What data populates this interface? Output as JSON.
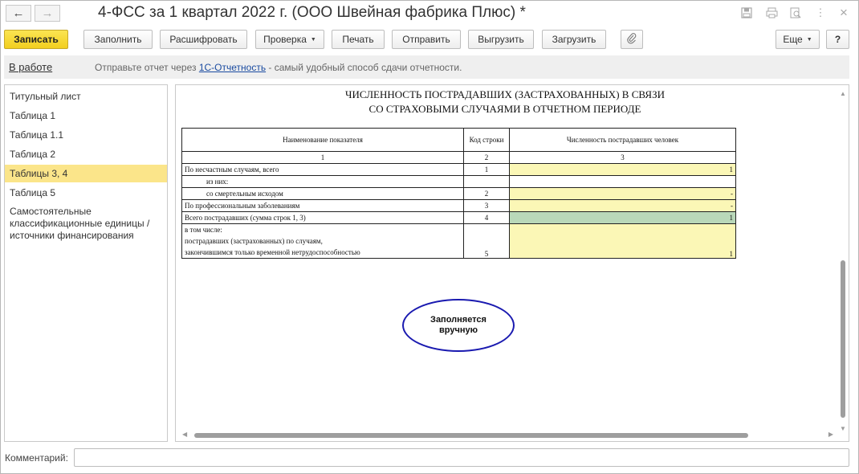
{
  "window": {
    "title": "4-ФСС за 1 квартал 2022 г. (ООО Швейная фабрика Плюс) *",
    "back_icon": "←",
    "forward_icon": "→",
    "icons": [
      "save-icon",
      "print-icon",
      "preview-icon",
      "more-icon",
      "close-icon"
    ],
    "more_glyph": "⋮",
    "close_glyph": "×"
  },
  "toolbar": {
    "save_label": "Записать",
    "fill_label": "Заполнить",
    "decode_label": "Расшифровать",
    "check_label": "Проверка",
    "print_label": "Печать",
    "send_label": "Отправить",
    "export_label": "Выгрузить",
    "import_label": "Загрузить",
    "attach_icon": "paperclip-icon",
    "more_label": "Еще",
    "help_label": "?"
  },
  "info": {
    "status_link": "В работе",
    "message_before": "Отправьте отчет через ",
    "message_link": "1С-Отчетность",
    "message_after": " - самый удобный способ сдачи отчетности."
  },
  "sidebar": {
    "items": [
      {
        "label": "Титульный лист",
        "active": false
      },
      {
        "label": "Таблица 1",
        "active": false
      },
      {
        "label": "Таблица 1.1",
        "active": false
      },
      {
        "label": "Таблица 2",
        "active": false
      },
      {
        "label": "Таблицы 3, 4",
        "active": true
      },
      {
        "label": "Таблица 5",
        "active": false
      },
      {
        "label": "Самостоятельные классификационные единицы / источники финансирования",
        "active": false
      }
    ]
  },
  "report": {
    "title_line1": "ЧИСЛЕННОСТЬ ПОСТРАДАВШИХ (ЗАСТРАХОВАННЫХ) В СВЯЗИ",
    "title_line2": "СО СТРАХОВЫМИ СЛУЧАЯМИ В ОТЧЕТНОМ ПЕРИОДЕ",
    "headers": {
      "name": "Наименование показателя",
      "code": "Код строки",
      "count": "Численность пострадавших человек"
    },
    "column_numbers": [
      "1",
      "2",
      "3"
    ],
    "rows": [
      {
        "name": "По несчастным случаям, всего",
        "code": "1",
        "value": "1"
      },
      {
        "name": "из них:",
        "code": "",
        "value": ""
      },
      {
        "name": "со смертельным исходом",
        "code": "2",
        "value": "-"
      },
      {
        "name": "По профессиональным заболеваниям",
        "code": "3",
        "value": "-"
      },
      {
        "name": "Всего пострадавших (сумма строк 1, 3)",
        "code": "4",
        "value": "1"
      },
      {
        "name_line1": "в том числе:",
        "name_line2": "пострадавших (застрахованных) по случаям,",
        "name_line3": "закончившимся только  временной  нетрудоспособностью",
        "code": "5",
        "value": "1"
      }
    ],
    "note_line1": "Заполняется",
    "note_line2": "вручную"
  },
  "comment": {
    "label": "Комментарий:",
    "value": ""
  },
  "colors": {
    "primary_button": "#f2cf1f",
    "editable_cell": "#fbf7b6",
    "calculated_cell": "#b9d8b9",
    "active_nav": "#fbe58a",
    "ellipse_border": "#1a1ab0",
    "link": "#1a4ba0"
  }
}
